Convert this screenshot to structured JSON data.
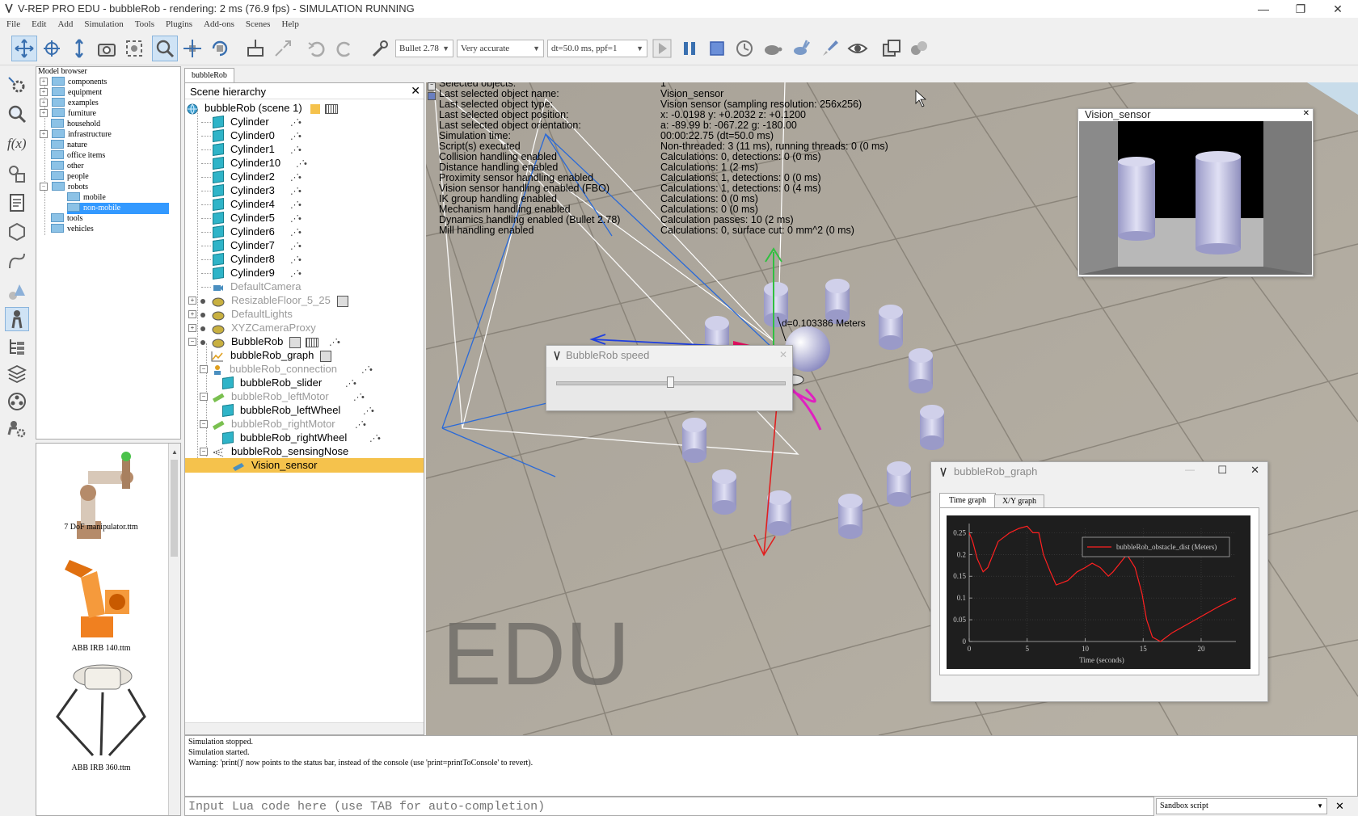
{
  "window": {
    "title": "V-REP PRO EDU - bubbleRob - rendering: 2 ms (76.9 fps) - SIMULATION RUNNING",
    "min_glyph": "—",
    "max_glyph": "❐",
    "close_glyph": "✕"
  },
  "menu": [
    "File",
    "Edit",
    "Add",
    "Simulation",
    "Tools",
    "Plugins",
    "Add-ons",
    "Scenes",
    "Help"
  ],
  "toolbar": {
    "engine": "Bullet 2.78",
    "accuracy": "Very accurate",
    "timestep": "dt=50.0 ms, ppf=1"
  },
  "model_browser": {
    "header": "Model browser",
    "items": [
      {
        "label": "components",
        "expander": "+"
      },
      {
        "label": "equipment",
        "expander": "+"
      },
      {
        "label": "examples",
        "expander": "+"
      },
      {
        "label": "furniture",
        "expander": "+"
      },
      {
        "label": "household",
        "expander": ""
      },
      {
        "label": "infrastructure",
        "expander": "+"
      },
      {
        "label": "nature",
        "expander": ""
      },
      {
        "label": "office items",
        "expander": ""
      },
      {
        "label": "other",
        "expander": ""
      },
      {
        "label": "people",
        "expander": ""
      },
      {
        "label": "robots",
        "expander": "−"
      },
      {
        "label": "mobile",
        "expander": ""
      },
      {
        "label": "non-mobile",
        "expander": ""
      },
      {
        "label": "tools",
        "expander": ""
      },
      {
        "label": "vehicles",
        "expander": ""
      }
    ],
    "thumbnails": [
      "7 DoF manipulator.ttm",
      "ABB IRB 140.ttm",
      "ABB IRB 360.ttm"
    ]
  },
  "scene_tab": "bubbleRob",
  "hierarchy": {
    "header": "Scene hierarchy",
    "root": "bubbleRob (scene 1)",
    "cylinders": [
      "Cylinder",
      "Cylinder0",
      "Cylinder1",
      "Cylinder10",
      "Cylinder2",
      "Cylinder3",
      "Cylinder4",
      "Cylinder5",
      "Cylinder6",
      "Cylinder7",
      "Cylinder8",
      "Cylinder9"
    ],
    "default_camera": "DefaultCamera",
    "resizable_floor": "ResizableFloor_5_25",
    "default_lights": "DefaultLights",
    "xyz_camera_proxy": "XYZCameraProxy",
    "bubblerob": "BubbleRob",
    "graph": "bubbleRob_graph",
    "connection": "bubbleRob_connection",
    "slider": "bubbleRob_slider",
    "left_motor": "bubbleRob_leftMotor",
    "left_wheel": "bubbleRob_leftWheel",
    "right_motor": "bubbleRob_rightMotor",
    "right_wheel": "bubbleRob_rightWheel",
    "sensing_nose": "bubbleRob_sensingNose",
    "vision_sensor": "Vision_sensor"
  },
  "info_overlay": {
    "labels": [
      "Selected objects:",
      "Last selected object name:",
      "Last selected object type:",
      "Last selected object position:",
      "Last selected object orientation:",
      "Simulation time:",
      "Script(s) executed",
      "Collision handling enabled",
      "Distance handling enabled",
      "Proximity sensor handling enabled",
      "Vision sensor handling enabled (FBO)",
      "IK group handling enabled",
      "Mechanism handling enabled",
      "Dynamics handling enabled (Bullet 2.78)",
      "Mill handling enabled"
    ],
    "values": [
      "1",
      "Vision_sensor",
      "Vision sensor (sampling resolution: 256x256)",
      "x: -0.0198    y: +0.2032    z: +0.1200",
      "a: -89.99    b: -067.22    g: -180.00",
      "00:00:22.75 (dt=50.0 ms)",
      "Non-threaded: 3 (11 ms), running threads: 0 (0 ms)",
      "Calculations: 0, detections: 0 (0 ms)",
      "Calculations: 1 (2 ms)",
      "Calculations: 1, detections: 0 (0 ms)",
      "Calculations: 1, detections: 0 (4 ms)",
      "Calculations: 0 (0 ms)",
      "Calculations: 0 (0 ms)",
      "Calculation passes: 10 (2 ms)",
      "Calculations: 0, surface cut: 0 mm^2 (0 ms)"
    ]
  },
  "distance_label": "d=0.103386 Meters",
  "watermark": "EDU",
  "vision_window": {
    "title": "Vision_sensor"
  },
  "speed_window": {
    "title": "BubbleRob speed",
    "slider_fraction": 0.5
  },
  "graph_window": {
    "title": "bubbleRob_graph",
    "tabs": [
      "Time graph",
      "X/Y graph"
    ]
  },
  "chart_data": {
    "type": "line",
    "title": "",
    "xlabel": "Time (seconds)",
    "ylabel": "",
    "xlim": [
      0,
      23
    ],
    "ylim": [
      0,
      0.26
    ],
    "xticks": [
      "0",
      "5",
      "10",
      "15",
      "20"
    ],
    "yticks": [
      "0",
      "0.05",
      "0.1",
      "0.15",
      "0.2",
      "0.25"
    ],
    "legend_position": "top-right",
    "grid": true,
    "series": [
      {
        "name": "bubbleRob_obstacle_dist (Meters)",
        "color": "#ff2020",
        "x": [
          0,
          0.3,
          0.7,
          1.2,
          1.6,
          2.5,
          3.5,
          4.3,
          5.0,
          5.5,
          6.0,
          6.4,
          7.0,
          7.5,
          8.5,
          9.3,
          10.0,
          10.6,
          11.3,
          12.0,
          12.4,
          13.0,
          13.6,
          14.3,
          14.9,
          15.3,
          15.8,
          16.5,
          17.5,
          19.5,
          21.5,
          23.0
        ],
        "y": [
          0.25,
          0.23,
          0.19,
          0.16,
          0.17,
          0.23,
          0.25,
          0.26,
          0.265,
          0.25,
          0.25,
          0.2,
          0.16,
          0.13,
          0.14,
          0.16,
          0.17,
          0.18,
          0.17,
          0.15,
          0.16,
          0.18,
          0.2,
          0.17,
          0.11,
          0.05,
          0.01,
          0.0,
          0.02,
          0.05,
          0.08,
          0.1
        ]
      }
    ]
  },
  "console": {
    "lines": [
      "Simulation stopped.",
      "Simulation started.",
      "Warning: 'print()' now points to the status bar, instead of the console (use 'print=printToConsole' to revert)."
    ],
    "input_placeholder": "Input Lua code here (use TAB for auto-completion)",
    "script_select": "Sandbox script",
    "close_glyph": "✕"
  },
  "colors": {
    "accent": "#3399ff",
    "selection": "#f5c24c",
    "plot_bg": "#1e1e1e",
    "plot_line": "#ff2020",
    "cylinder": "#c8c8e6",
    "floor": "#a8a298"
  }
}
